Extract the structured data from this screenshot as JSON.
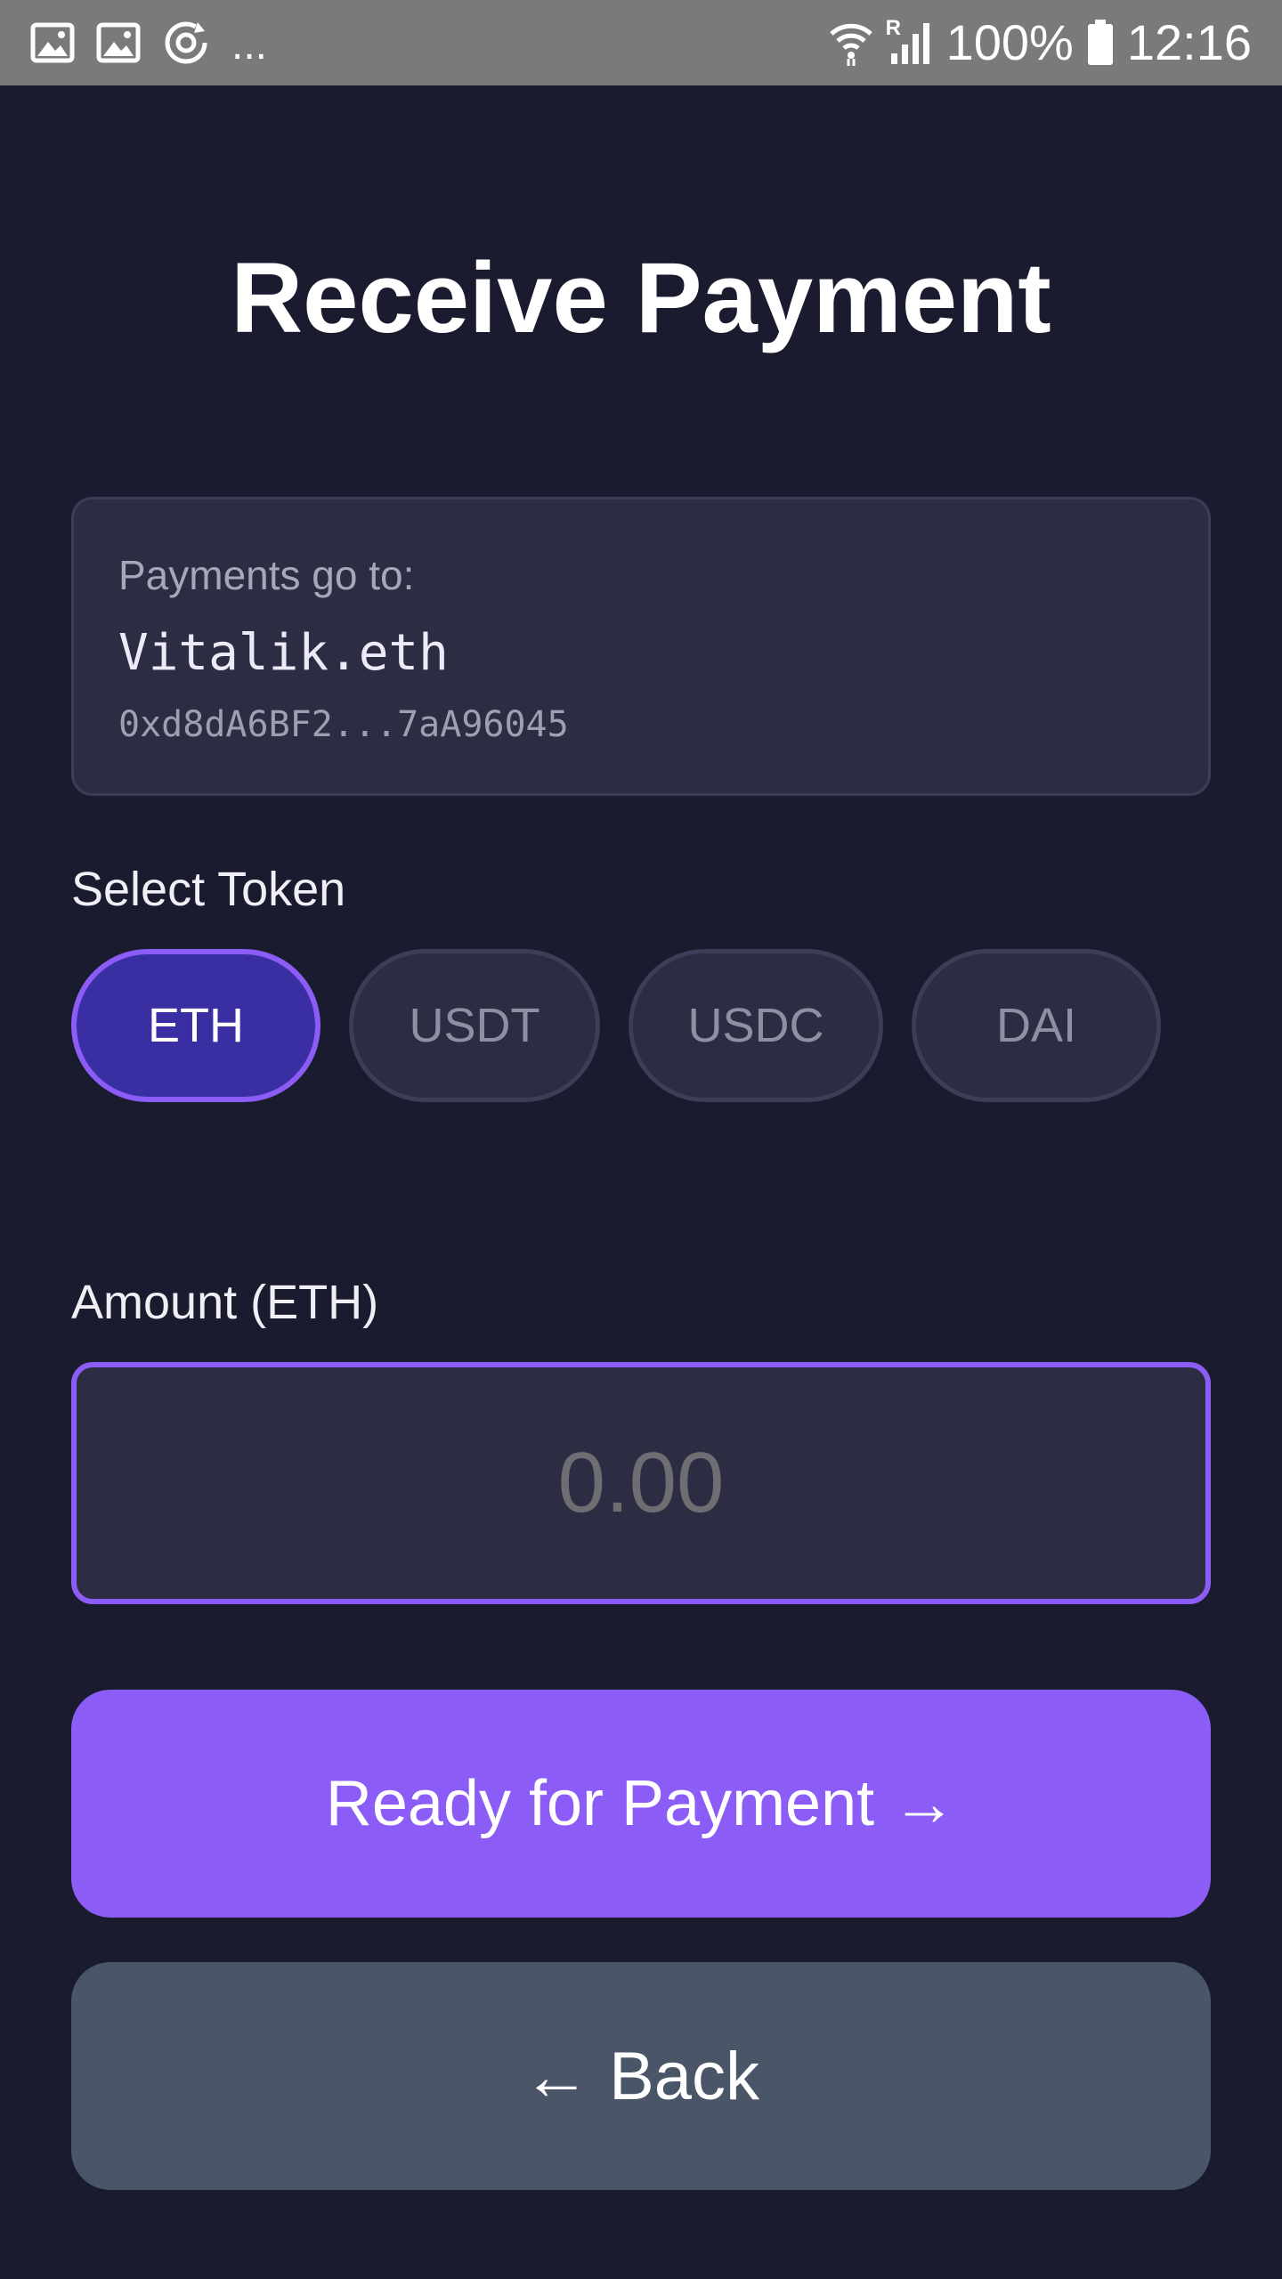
{
  "status_bar": {
    "left_icons": [
      "image-icon",
      "image-icon",
      "sync-icon"
    ],
    "overflow": "...",
    "roaming": "R",
    "battery": "100%",
    "time": "12:16"
  },
  "title": "Receive Payment",
  "recipient": {
    "label": "Payments go to:",
    "name": "Vitalik.eth",
    "address": "0xd8dA6BF2...7aA96045"
  },
  "token_select": {
    "label": "Select Token",
    "options": [
      "ETH",
      "USDT",
      "USDC",
      "DAI"
    ],
    "selected": "ETH"
  },
  "amount": {
    "label": "Amount (ETH)",
    "placeholder": "0.00",
    "value": ""
  },
  "buttons": {
    "ready": "Ready for Payment →",
    "back": "← Back"
  },
  "colors": {
    "background": "#1b1b2f",
    "card": "#2c2c43",
    "accent": "#8b5cf6",
    "selected_token": "#3a2ea3",
    "secondary_button": "#4a5568"
  }
}
